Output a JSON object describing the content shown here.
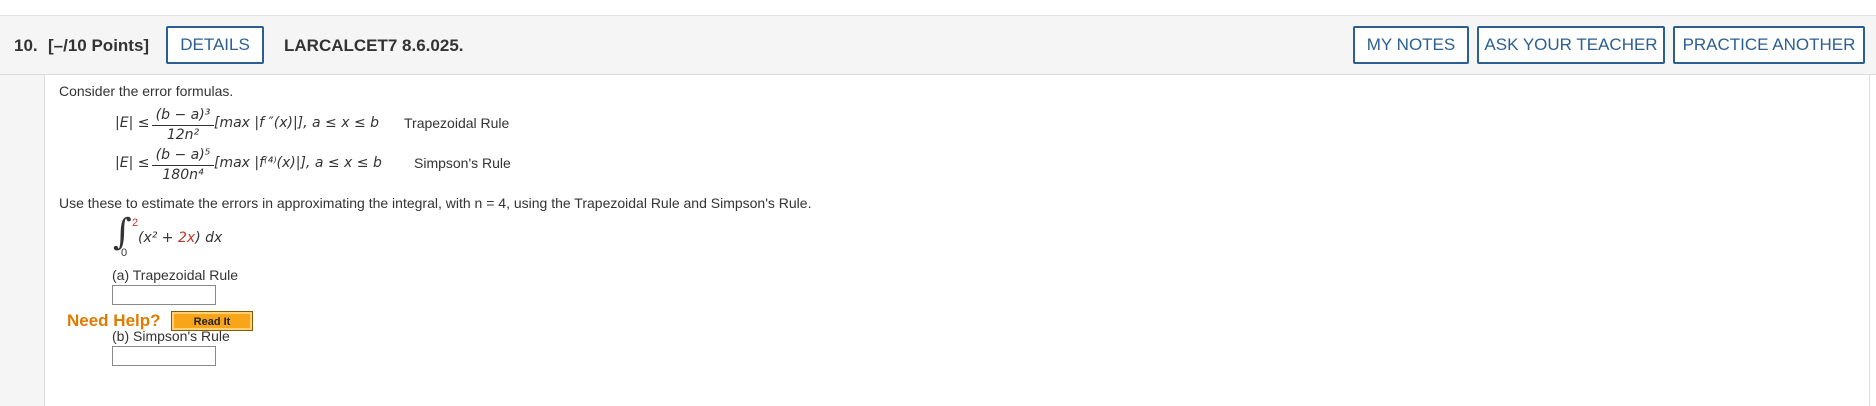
{
  "question": {
    "number": "10.",
    "points": "[–/10 Points]",
    "details_label": "DETAILS",
    "code": "LARCALCET7 8.6.025."
  },
  "toolbar": {
    "my_notes_label": "MY NOTES",
    "ask_teacher_label": "ASK YOUR TEACHER",
    "practice_label": "PRACTICE ANOTHER"
  },
  "content": {
    "intro": "Consider the error formulas.",
    "trap": {
      "lhs": "|E| ≤",
      "num": "(b − a)³",
      "den": "12n²",
      "rest": "[max |f ″(x)|],  a ≤ x ≤ b",
      "name": "Trapezoidal Rule"
    },
    "simp": {
      "lhs": "|E| ≤",
      "num": "(b − a)⁵",
      "den": "180n⁴",
      "rest": "[max |f⁽⁴⁾(x)|],  a ≤ x ≤ b",
      "name": "Simpson's Rule"
    },
    "instruction": "Use these to estimate the errors in approximating the integral, with n = 4, using the Trapezoidal Rule and Simpson's Rule.",
    "integral": {
      "symbol": "∫",
      "upper": "2",
      "lower": "0",
      "integrand_pre": "(x² + ",
      "integrand_red": "2x",
      "integrand_post": ") dx"
    },
    "part_a_label": "(a) Trapezoidal Rule",
    "part_b_label": "(b) Simpson's Rule",
    "part_a_value": "",
    "part_b_value": ""
  },
  "help": {
    "need_help": "Need Help?",
    "read_it": "Read It"
  },
  "colors": {
    "button_border": "#2b5f91",
    "help_orange": "#e07b00",
    "readit_bg": "#f9a51a",
    "accent_red": "#c0392b"
  }
}
